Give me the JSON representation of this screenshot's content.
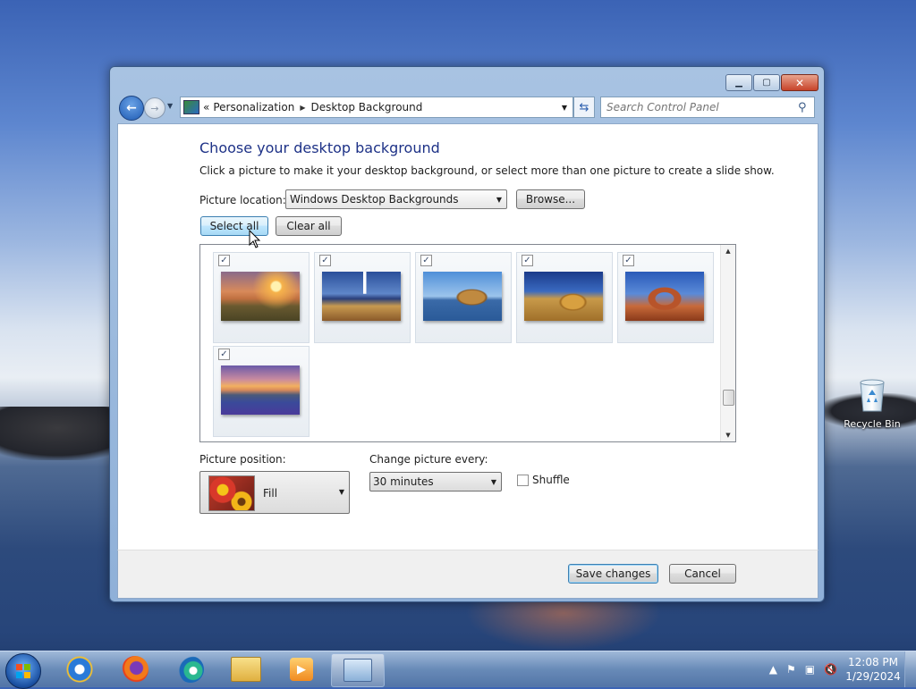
{
  "desktop": {
    "recycle_bin_label": "Recycle Bin"
  },
  "window": {
    "caption_buttons": {
      "minimize_icon": "minimize-icon",
      "maximize_icon": "maximize-icon",
      "close_icon": "close-icon"
    },
    "address": {
      "overflow": "«",
      "crumbs": [
        "Personalization",
        "Desktop Background"
      ]
    },
    "search": {
      "placeholder": "Search Control Panel"
    },
    "title": "Choose your desktop background",
    "subtitle": "Click a picture to make it your desktop background, or select more than one picture to create a slide show.",
    "picture_location": {
      "label": "Picture location:",
      "value": "Windows Desktop Backgrounds",
      "browse_label": "Browse..."
    },
    "select_all_label": "Select all",
    "clear_all_label": "Clear all",
    "gallery": {
      "tiles": [
        {
          "checked": true,
          "name": "sunset-field"
        },
        {
          "checked": true,
          "name": "lighthouse"
        },
        {
          "checked": true,
          "name": "sea-rock"
        },
        {
          "checked": true,
          "name": "hay-bale"
        },
        {
          "checked": true,
          "name": "delicate-arch"
        },
        {
          "checked": true,
          "name": "lake-flowers"
        }
      ]
    },
    "picture_position": {
      "label": "Picture position:",
      "value": "Fill"
    },
    "change_every": {
      "label": "Change picture every:",
      "value": "30 minutes"
    },
    "shuffle": {
      "label": "Shuffle",
      "checked": false
    },
    "footer": {
      "save_label": "Save changes",
      "cancel_label": "Cancel"
    }
  },
  "taskbar": {
    "apps": [
      "internet-explorer",
      "firefox",
      "edge",
      "file-explorer",
      "media-player",
      "control-panel"
    ],
    "clock": {
      "time": "12:08 PM",
      "date": "1/29/2024"
    }
  },
  "colors": {
    "title_blue": "#1e3287",
    "accent": "#3c7fb1"
  }
}
